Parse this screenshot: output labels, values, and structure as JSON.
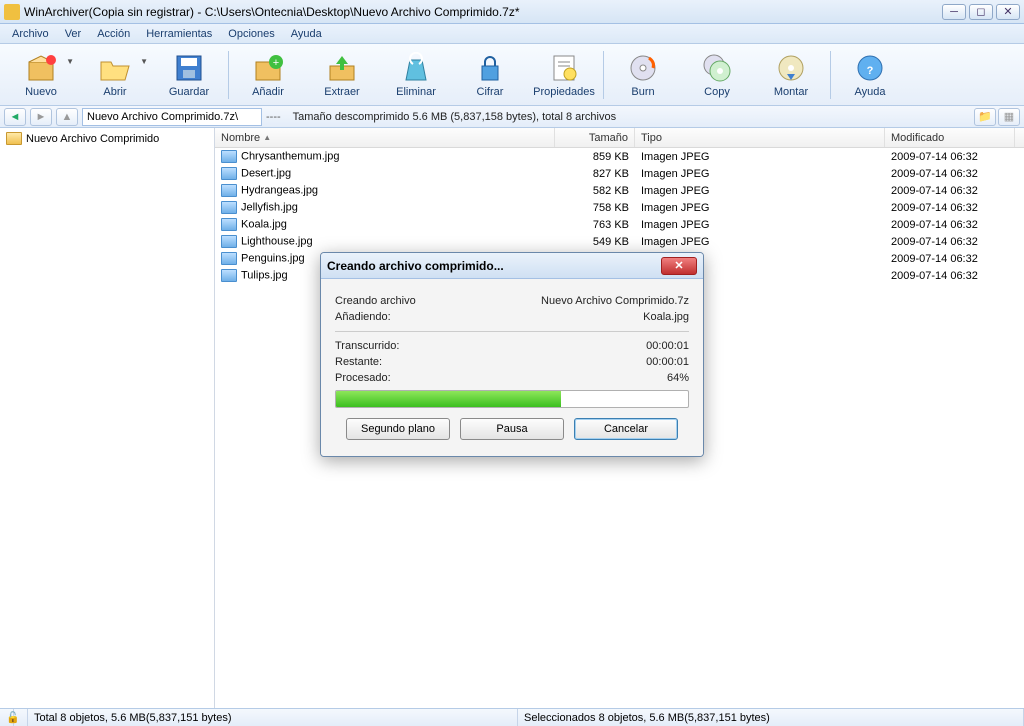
{
  "title": "WinArchiver(Copia sin registrar) - C:\\Users\\Ontecnia\\Desktop\\Nuevo Archivo Comprimido.7z*",
  "menu": [
    "Archivo",
    "Ver",
    "Acción",
    "Herramientas",
    "Opciones",
    "Ayuda"
  ],
  "toolbar": [
    {
      "id": "nuevo",
      "label": "Nuevo",
      "dd": true,
      "icon": "box-new"
    },
    {
      "id": "abrir",
      "label": "Abrir",
      "dd": true,
      "icon": "folder-open"
    },
    {
      "id": "guardar",
      "label": "Guardar",
      "icon": "save"
    },
    {
      "sep": true
    },
    {
      "id": "anadir",
      "label": "Añadir",
      "icon": "box-add"
    },
    {
      "id": "extraer",
      "label": "Extraer",
      "icon": "box-out"
    },
    {
      "id": "eliminar",
      "label": "Eliminar",
      "icon": "recycle"
    },
    {
      "id": "cifrar",
      "label": "Cifrar",
      "icon": "lock"
    },
    {
      "id": "propiedades",
      "label": "Propiedades",
      "icon": "props"
    },
    {
      "sep": true
    },
    {
      "id": "burn",
      "label": "Burn",
      "icon": "disc-burn"
    },
    {
      "id": "copy",
      "label": "Copy",
      "icon": "disc-copy"
    },
    {
      "id": "montar",
      "label": "Montar",
      "icon": "disc-mount"
    },
    {
      "sep": true
    },
    {
      "id": "ayuda",
      "label": "Ayuda",
      "icon": "help"
    }
  ],
  "path": {
    "current": "Nuevo Archivo Comprimido.7z\\",
    "sep": "----",
    "summary": "Tamaño descomprimido 5.6 MB (5,837,158 bytes), total 8 archivos"
  },
  "tree_root": "Nuevo Archivo Comprimido",
  "columns": {
    "name": "Nombre",
    "size": "Tamaño",
    "type": "Tipo",
    "mod": "Modificado"
  },
  "files": [
    {
      "name": "Chrysanthemum.jpg",
      "size": "859 KB",
      "type": "Imagen JPEG",
      "mod": "2009-07-14 06:32"
    },
    {
      "name": "Desert.jpg",
      "size": "827 KB",
      "type": "Imagen JPEG",
      "mod": "2009-07-14 06:32"
    },
    {
      "name": "Hydrangeas.jpg",
      "size": "582 KB",
      "type": "Imagen JPEG",
      "mod": "2009-07-14 06:32"
    },
    {
      "name": "Jellyfish.jpg",
      "size": "758 KB",
      "type": "Imagen JPEG",
      "mod": "2009-07-14 06:32"
    },
    {
      "name": "Koala.jpg",
      "size": "763 KB",
      "type": "Imagen JPEG",
      "mod": "2009-07-14 06:32"
    },
    {
      "name": "Lighthouse.jpg",
      "size": "549 KB",
      "type": "Imagen JPEG",
      "mod": "2009-07-14 06:32"
    },
    {
      "name": "Penguins.jpg",
      "size": "",
      "type": "",
      "mod": "2009-07-14 06:32"
    },
    {
      "name": "Tulips.jpg",
      "size": "",
      "type": "",
      "mod": "2009-07-14 06:32"
    }
  ],
  "status": {
    "left": "Total 8 objetos, 5.6 MB(5,837,151 bytes)",
    "right": "Seleccionados 8 objetos, 5.6 MB(5,837,151 bytes)"
  },
  "dialog": {
    "title": "Creando archivo comprimido...",
    "creating_label": "Creando archivo",
    "creating_value": "Nuevo Archivo Comprimido.7z",
    "adding_label": "Añadiendo:",
    "adding_value": "Koala.jpg",
    "elapsed_label": "Transcurrido:",
    "elapsed_value": "00:00:01",
    "remaining_label": "Restante:",
    "remaining_value": "00:00:01",
    "processed_label": "Procesado:",
    "processed_value": "64%",
    "progress_percent": 64,
    "btn_background": "Segundo plano",
    "btn_pause": "Pausa",
    "btn_cancel": "Cancelar"
  }
}
